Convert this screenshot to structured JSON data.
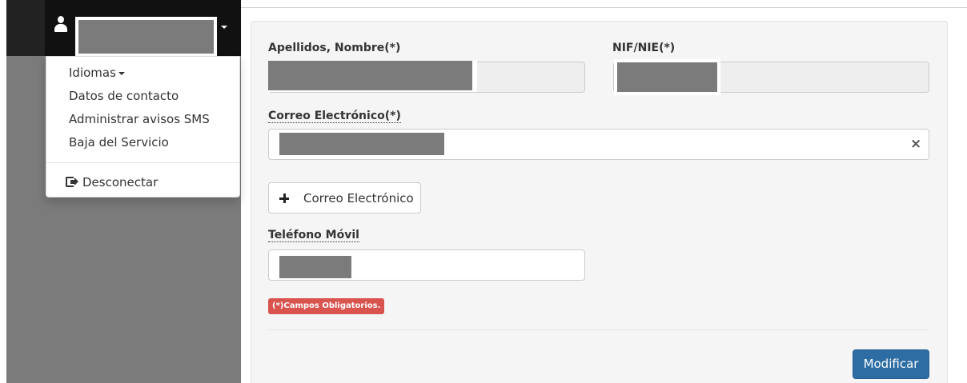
{
  "user_menu": {
    "user_name": "",
    "items": [
      {
        "label": "Idiomas"
      },
      {
        "label": "Datos de contacto"
      },
      {
        "label": "Administrar avisos SMS"
      },
      {
        "label": "Baja del Servicio"
      }
    ],
    "logout_label": "Desconectar"
  },
  "form": {
    "nombre_label": "Apellidos, Nombre(*)",
    "nif_label": "NIF/NIE(*)",
    "email_label": "Correo Electrónico(*)",
    "telefono_label": "Teléfono Móvil",
    "nombre_value": "",
    "nif_value": "",
    "email_value": "",
    "telefono_value": "",
    "add_email_button": "Correo Electrónico",
    "required_note": "(*)Campos Obligatorios.",
    "submit_button": "Modificar"
  },
  "icons": {
    "user": "user-icon",
    "caret": "caret-down-icon",
    "logout": "sign-out-icon",
    "clear": "close-icon",
    "add": "plus-icon"
  },
  "colors": {
    "primary": "#2e6da4",
    "danger": "#d9534f",
    "topbar": "#111111",
    "sidebar": "#7b7b7b"
  }
}
